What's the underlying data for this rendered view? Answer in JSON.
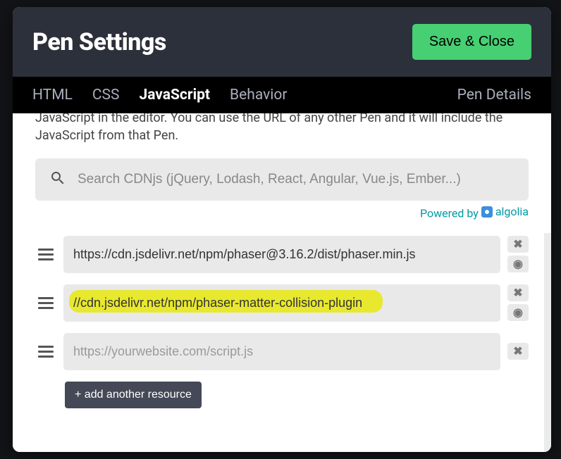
{
  "header": {
    "title": "Pen Settings",
    "save_label": "Save & Close"
  },
  "tabs": {
    "html": "HTML",
    "css": "CSS",
    "javascript": "JavaScript",
    "behavior": "Behavior",
    "pen_details": "Pen Details"
  },
  "desc_text": "JavaScript in the editor. You can use the URL of any other Pen and it will include the JavaScript from that Pen.",
  "search": {
    "placeholder": "Search CDNjs (jQuery, Lodash, React, Angular, Vue.js, Ember...)"
  },
  "powered_by_label": "Powered by",
  "algolia_label": "algolia",
  "resources": [
    {
      "value": "https://cdn.jsdelivr.net/npm/phaser@3.16.2/dist/phaser.min.js",
      "highlighted": false
    },
    {
      "value": "//cdn.jsdelivr.net/npm/phaser-matter-collision-plugin",
      "highlighted": true
    },
    {
      "value": "",
      "placeholder": "https://yourwebsite.com/script.js",
      "highlighted": false
    }
  ],
  "add_button_label": "+ add another resource",
  "icons": {
    "remove": "✖",
    "preview": "◉"
  }
}
